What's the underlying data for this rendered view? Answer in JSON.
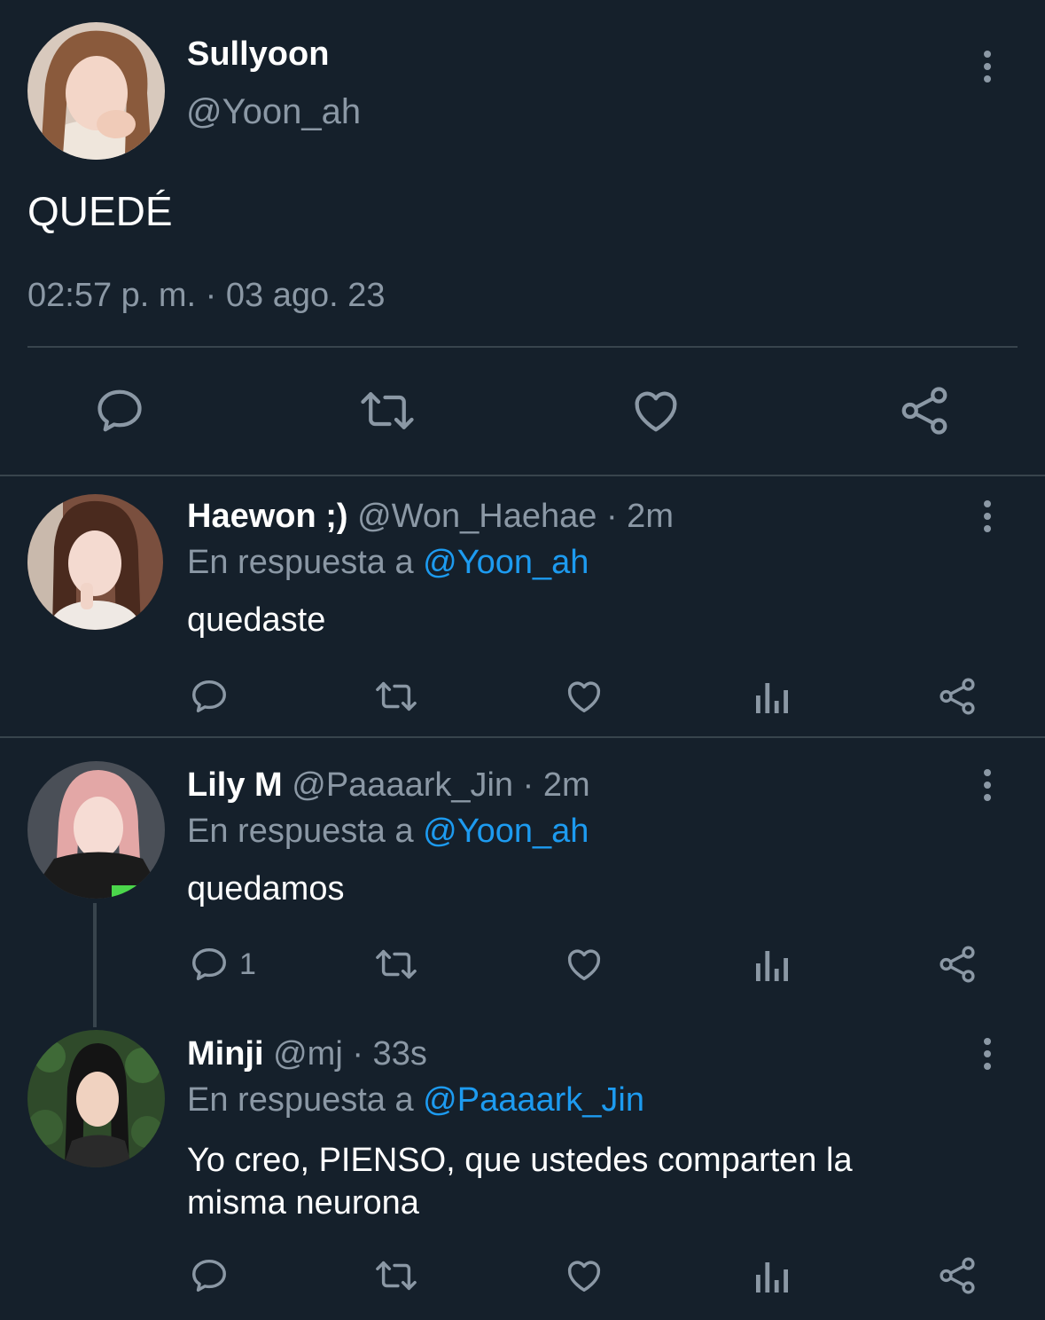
{
  "main_tweet": {
    "display_name": "Sullyoon",
    "handle": "@Yoon_ah",
    "text": "QUEDÉ",
    "timestamp": "02:57 p. m. · 03 ago. 23"
  },
  "replies": [
    {
      "display_name": "Haewon ;)",
      "handle": "@Won_Haehae",
      "age": "· 2m",
      "reply_prefix": "En respuesta a",
      "reply_to": "@Yoon_ah",
      "text": "quedaste",
      "reply_count": ""
    },
    {
      "display_name": "Lily M",
      "handle": "@Paaaark_Jin",
      "age": "· 2m",
      "reply_prefix": "En respuesta a",
      "reply_to": "@Yoon_ah",
      "text": "quedamos",
      "reply_count": "1"
    },
    {
      "display_name": "Minji",
      "handle": "@mj",
      "age": "· 33s",
      "reply_prefix": "En respuesta a",
      "reply_to": "@Paaaark_Jin",
      "text": "Yo creo, PIENSO, que ustedes comparten la misma neurona",
      "reply_count": ""
    }
  ],
  "icons": {
    "reply": "reply-icon",
    "retweet": "retweet-icon",
    "like": "like-icon",
    "views": "views-icon",
    "share": "share-icon",
    "more": "more-icon"
  },
  "colors": {
    "background": "#15202b",
    "muted": "#8b98a5",
    "link": "#1d9bf0",
    "divider": "#38444d"
  }
}
